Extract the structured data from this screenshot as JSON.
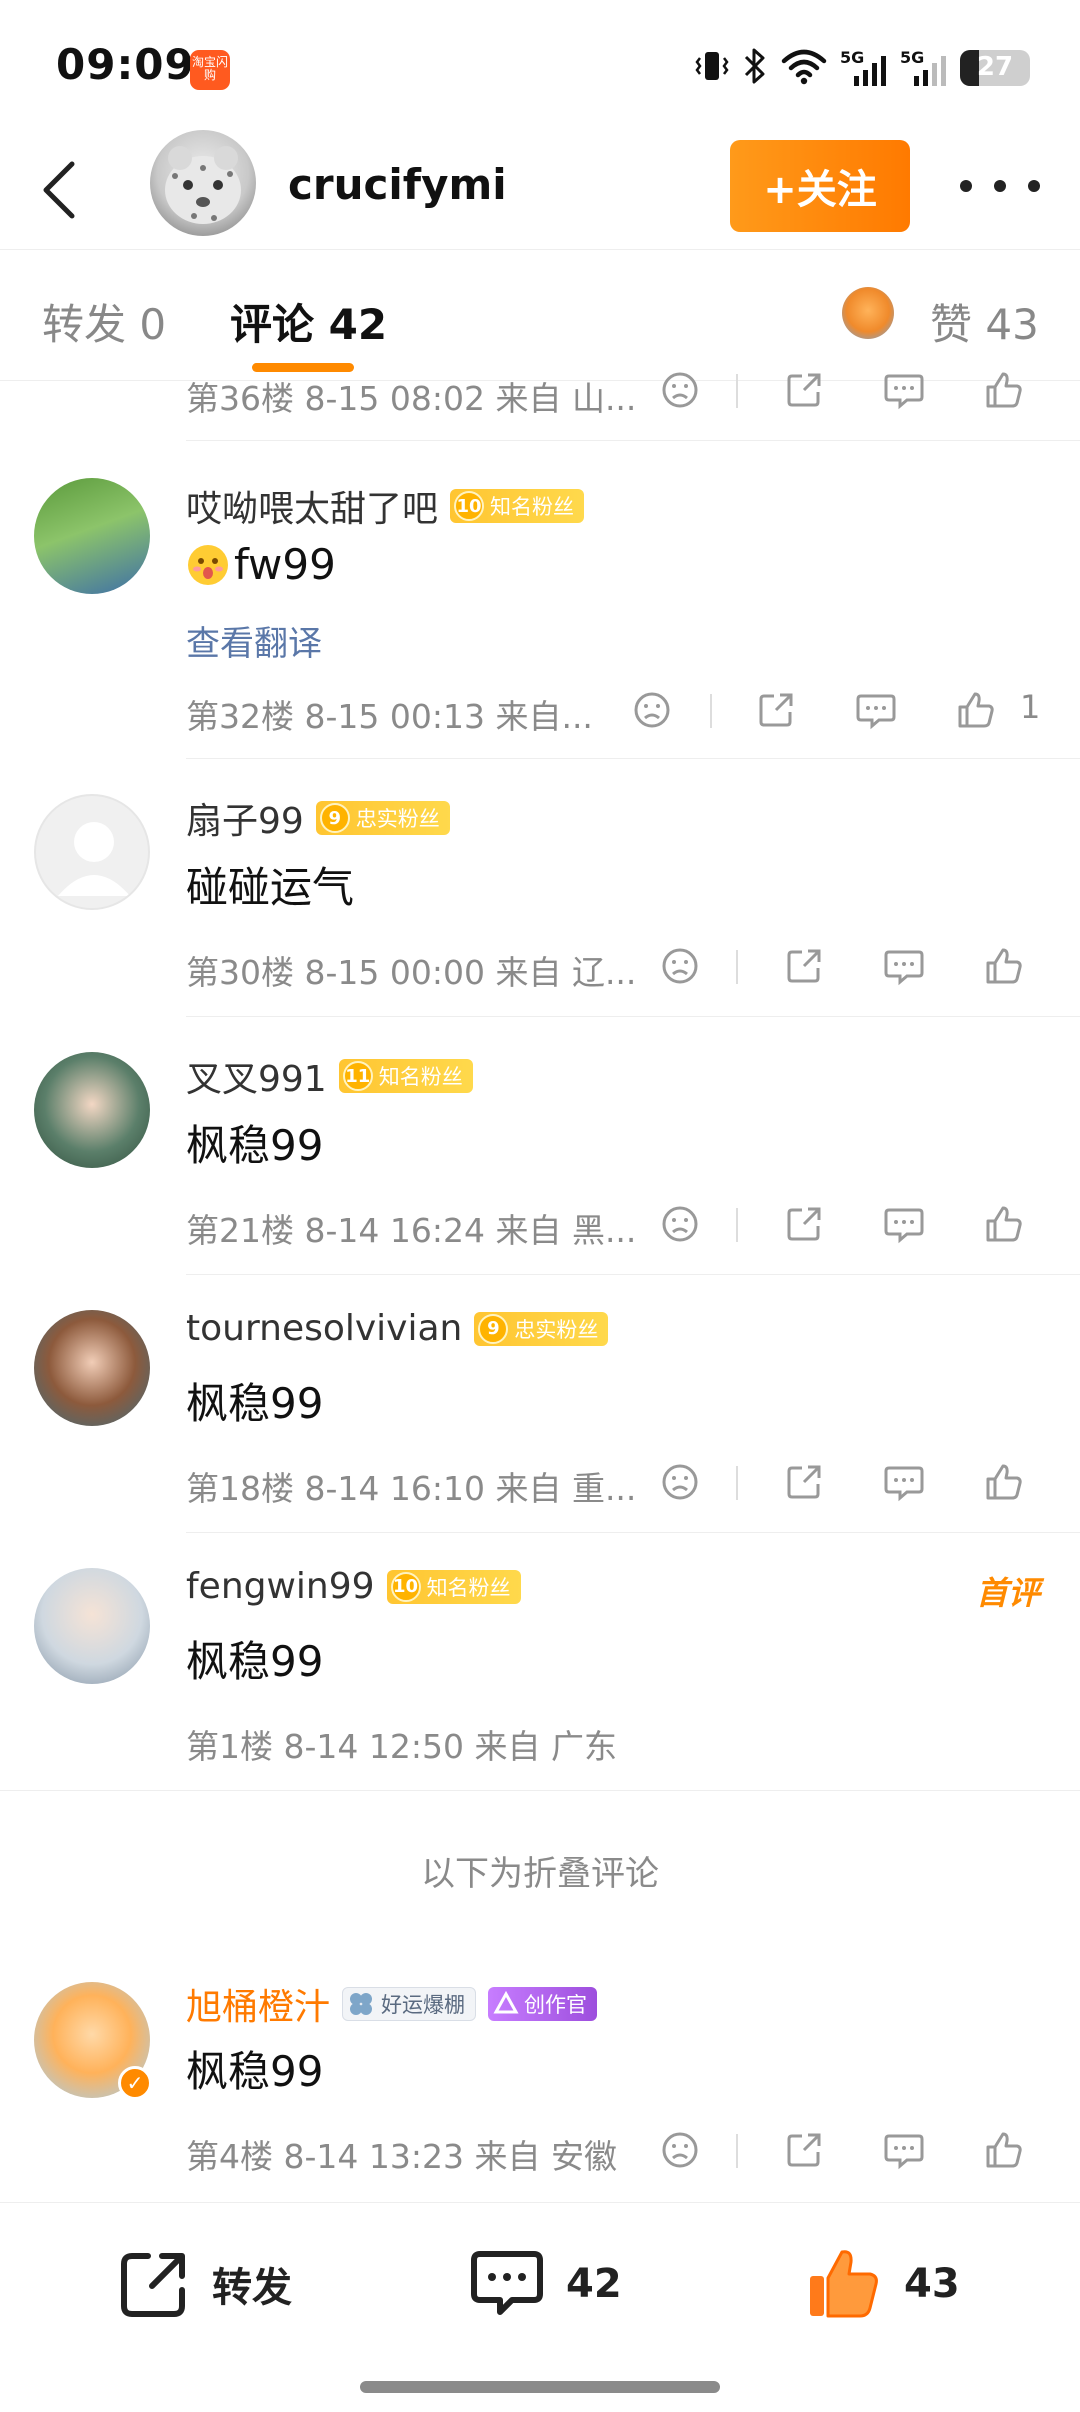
{
  "status_bar": {
    "time": "09:09",
    "app_icon_label": "淘宝闪购",
    "battery_level": "27"
  },
  "header": {
    "username": "crucifymi",
    "follow_label": "+关注"
  },
  "tabs": {
    "repost": "转发 0",
    "comments": "评论 42",
    "likes": "赞 43"
  },
  "comments": [
    {
      "meta": "第36楼  8-15 08:02  来自 山..."
    },
    {
      "name": "哎呦喂太甜了吧",
      "badge_level": "10",
      "badge_label": "知名粉丝",
      "text": "fw99",
      "translate": "查看翻译",
      "meta": "第32楼  8-15 00:13  来自...",
      "likes": "1"
    },
    {
      "name": "扇子99",
      "badge_level": "9",
      "badge_label": "忠实粉丝",
      "text": "碰碰运气",
      "meta": "第30楼  8-15 00:00  来自 辽..."
    },
    {
      "name": "叉叉991",
      "badge_level": "11",
      "badge_label": "知名粉丝",
      "text": "枫稳99",
      "meta": "第21楼  8-14 16:24  来自 黑..."
    },
    {
      "name": "tournesolvivian",
      "badge_level": "9",
      "badge_label": "忠实粉丝",
      "text": "枫稳99",
      "meta": "第18楼  8-14 16:10  来自 重..."
    },
    {
      "name": "fengwin99",
      "badge_level": "10",
      "badge_label": "知名粉丝",
      "text": "枫稳99",
      "meta": "第1楼  8-14 12:50  来自 广东",
      "tag": "首评"
    }
  ],
  "folded_label": "以下为折叠评论",
  "folded_comment": {
    "name": "旭桶橙汁",
    "badge_1": "好运爆棚",
    "badge_2": "创作官",
    "text": "枫稳99",
    "meta": "第4楼  8-14 13:23  来自 安徽"
  },
  "bottom_bar": {
    "repost_label": "转发",
    "comment_count": "42",
    "like_count": "43"
  },
  "colors": {
    "accent": "#ff8a00",
    "link": "#5a77a8",
    "meta": "#8a8a8a"
  }
}
